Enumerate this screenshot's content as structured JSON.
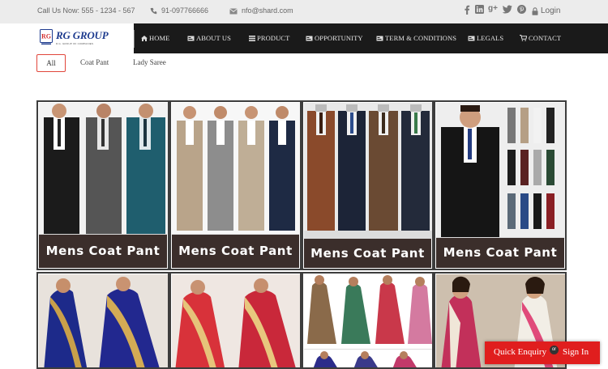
{
  "topbar": {
    "call": "Call Us Now: 555 - 1234 - 567",
    "phone": "91-097766666",
    "email": "nfo@shard.com",
    "login": "Login",
    "social_icons": [
      "facebook-icon",
      "linkedin-icon",
      "google-plus-icon",
      "twitter-icon",
      "pinterest-icon"
    ]
  },
  "brand": {
    "name": "RG GROUP",
    "tagline": "R.G. GROUP OF COMPANIES"
  },
  "nav": [
    {
      "label": "HOME",
      "icon": "home-icon"
    },
    {
      "label": "ABOUT US",
      "icon": "card-icon"
    },
    {
      "label": "PRODUCT",
      "icon": "list-icon"
    },
    {
      "label": "OPPORTUNITY",
      "icon": "card-icon"
    },
    {
      "label": "TERM & CONDITIONS",
      "icon": "card-icon"
    },
    {
      "label": "LEGALS",
      "icon": "card-icon"
    },
    {
      "label": "CONTACT",
      "icon": "cart-icon"
    }
  ],
  "filters": [
    "All",
    "Coat Pant",
    "Lady Saree"
  ],
  "active_filter": "All",
  "gallery": [
    {
      "caption": "Mens Coat Pant",
      "category": "Coat Pant"
    },
    {
      "caption": "Mens Coat Pant",
      "category": "Coat Pant"
    },
    {
      "caption": "Mens Coat Pant",
      "category": "Coat Pant"
    },
    {
      "caption": "Mens Coat Pant",
      "category": "Coat Pant"
    },
    {
      "caption": "",
      "category": "Lady Saree"
    },
    {
      "caption": "",
      "category": "Lady Saree"
    },
    {
      "caption": "",
      "category": "Lady Saree"
    },
    {
      "caption": "",
      "category": "Lady Saree"
    }
  ],
  "enquiry": {
    "quick": "Quick Enquiry",
    "or": "or",
    "signin": "Sign In"
  },
  "colors": {
    "accent": "#e1463b",
    "navbar": "#1a1a1a",
    "brand_text": "#1f3c8f",
    "caption_bg": "#3b2e2b",
    "enquiry_bg": "#e01e1e"
  }
}
